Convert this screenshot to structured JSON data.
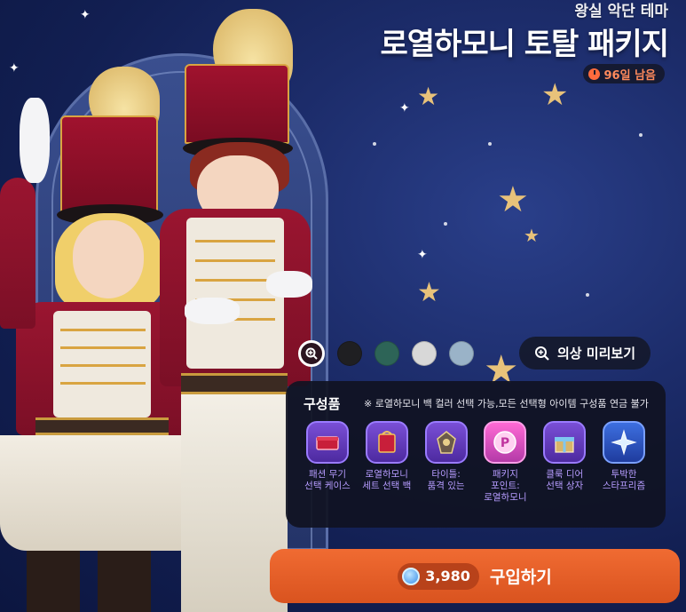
{
  "header": {
    "subtitle": "왕실 악단 테마",
    "title": "로열하모니 토탈 패키지",
    "days_left": "96일 남음"
  },
  "colors": {
    "swatches": [
      "#2a1420",
      "#1f1f22",
      "#2d6457",
      "#d8d8d8",
      "#9ab3c8"
    ],
    "accent": "#e8612a",
    "item_label": "#b69cff"
  },
  "preview": {
    "label": "의상 미리보기"
  },
  "contents": {
    "title": "구성품",
    "note": "※ 로열하모니 백 컬러 선택 가능,모든 선택형 아이템 구성품 연금 불가",
    "items": [
      {
        "icon": "red-weapon-case-icon",
        "label": "패션 무기\n선택 케이스"
      },
      {
        "icon": "red-bag-icon",
        "label": "로열하모니\n세트 선택 백"
      },
      {
        "icon": "title-badge-icon",
        "label": "타이틀:\n품격 있는"
      },
      {
        "icon": "package-point-icon",
        "label": "패키지\n포인트:\n로열하모니"
      },
      {
        "icon": "gift-box-icon",
        "label": "클룩 디어\n선택 상자"
      },
      {
        "icon": "star-prism-icon",
        "label": "투박한\n스타프리즘"
      }
    ]
  },
  "purchase": {
    "price": "3,980",
    "label": "구입하기"
  }
}
